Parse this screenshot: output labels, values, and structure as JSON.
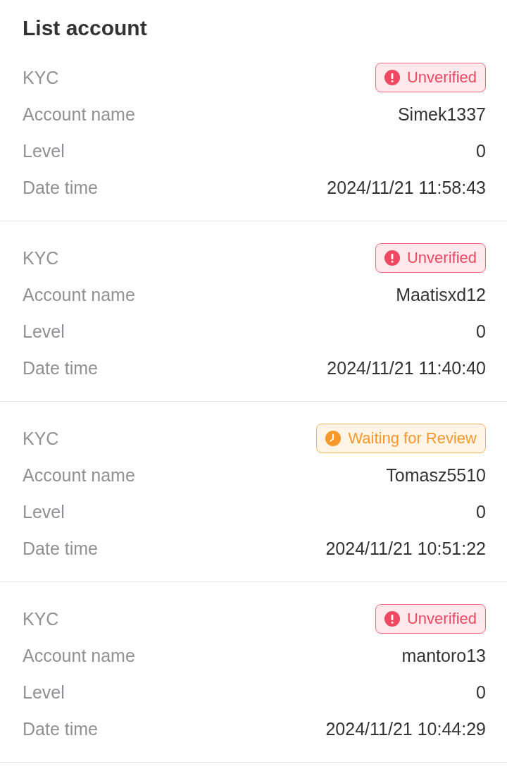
{
  "title": "List account",
  "accounts": [
    {
      "kyc": {
        "label": "KYC",
        "status": {
          "kind": "unverified",
          "text": "Unverified"
        }
      },
      "fields": [
        {
          "label": "Account name",
          "value": "Simek1337"
        },
        {
          "label": "Level",
          "value": "0"
        },
        {
          "label": "Date time",
          "value": "2024/11/21 11:58:43"
        }
      ]
    },
    {
      "kyc": {
        "label": "KYC",
        "status": {
          "kind": "unverified",
          "text": "Unverified"
        }
      },
      "fields": [
        {
          "label": "Account name",
          "value": "Maatisxd12"
        },
        {
          "label": "Level",
          "value": "0"
        },
        {
          "label": "Date time",
          "value": "2024/11/21 11:40:40"
        }
      ]
    },
    {
      "kyc": {
        "label": "KYC",
        "status": {
          "kind": "waiting",
          "text": "Waiting for Review"
        }
      },
      "fields": [
        {
          "label": "Account name",
          "value": "Tomasz5510"
        },
        {
          "label": "Level",
          "value": "0"
        },
        {
          "label": "Date time",
          "value": "2024/11/21 10:51:22"
        }
      ]
    },
    {
      "kyc": {
        "label": "KYC",
        "status": {
          "kind": "unverified",
          "text": "Unverified"
        }
      },
      "fields": [
        {
          "label": "Account name",
          "value": "mantoro13"
        },
        {
          "label": "Level",
          "value": "0"
        },
        {
          "label": "Date time",
          "value": "2024/11/21 10:44:29"
        }
      ]
    }
  ]
}
